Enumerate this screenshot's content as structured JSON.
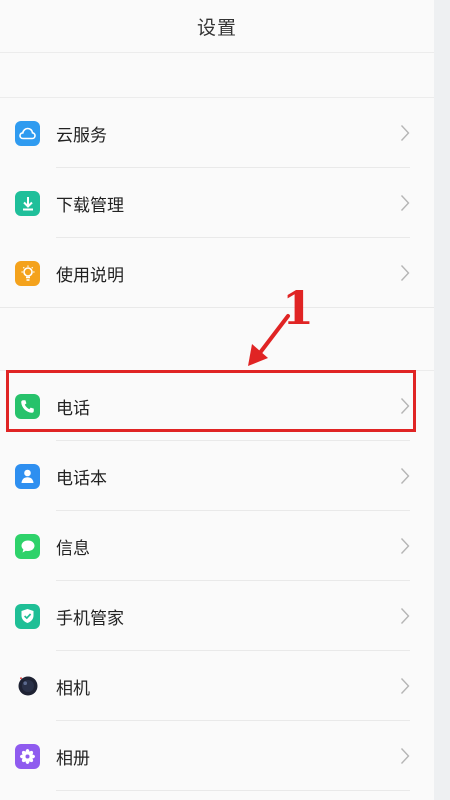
{
  "header": {
    "title": "设置"
  },
  "sections": [
    {
      "items": [
        {
          "name": "cloud",
          "label": "云服务",
          "icon": "cloud-icon",
          "color": "#2f9bf0"
        },
        {
          "name": "download",
          "label": "下载管理",
          "icon": "download-icon",
          "color": "#1fbf9a"
        },
        {
          "name": "guide",
          "label": "使用说明",
          "icon": "lightbulb-icon",
          "color": "#f4a21c"
        }
      ]
    },
    {
      "items": [
        {
          "name": "phone",
          "label": "电话",
          "icon": "phone-icon",
          "color": "#27c26b"
        },
        {
          "name": "contacts",
          "label": "电话本",
          "icon": "contacts-icon",
          "color": "#2e8ff0"
        },
        {
          "name": "messages",
          "label": "信息",
          "icon": "message-icon",
          "color": "#2ed26a"
        },
        {
          "name": "phone-manager",
          "label": "手机管家",
          "icon": "shield-icon",
          "color": "#1fbf96"
        },
        {
          "name": "camera",
          "label": "相机",
          "icon": "camera-icon",
          "color": "#1e2233"
        },
        {
          "name": "album",
          "label": "相册",
          "icon": "flower-icon",
          "color": "#8f5bef"
        }
      ]
    }
  ],
  "annotation": {
    "step": "1",
    "color": "#e02424"
  }
}
